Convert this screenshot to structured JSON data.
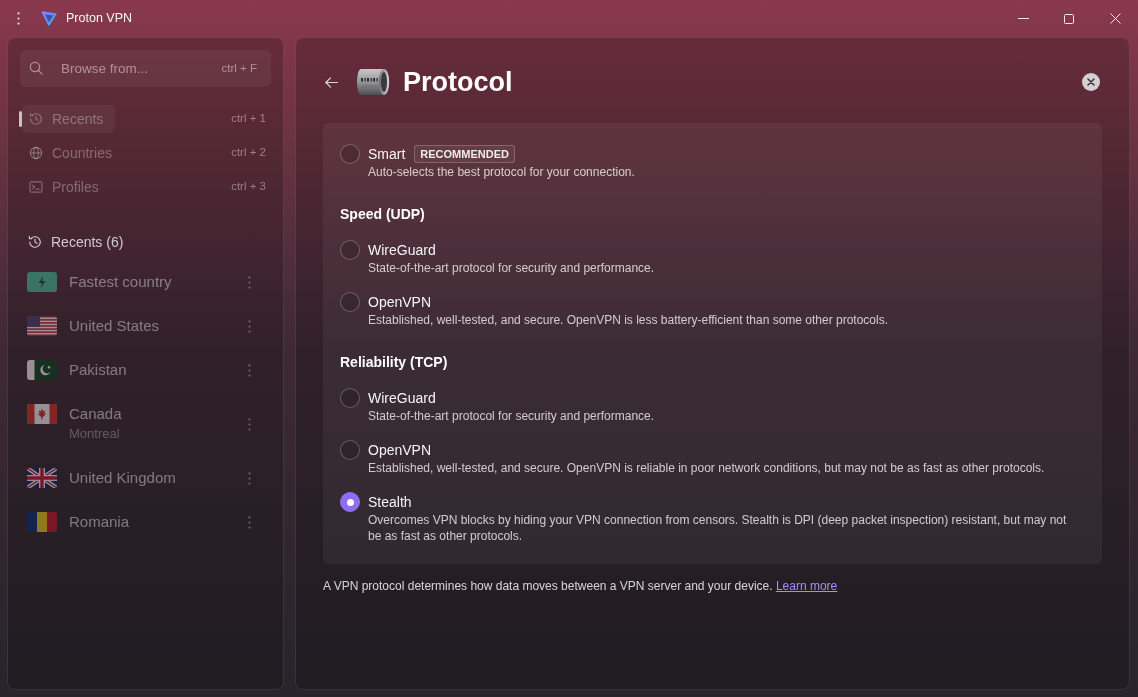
{
  "window": {
    "title": "Proton VPN"
  },
  "sidebar": {
    "search": {
      "placeholder": "Browse from...",
      "shortcut": "ctrl + F"
    },
    "nav_items": [
      {
        "kind": "recents",
        "label": "Recents",
        "shortcut": "ctrl + 1",
        "selected": true
      },
      {
        "kind": "countries",
        "label": "Countries",
        "shortcut": "ctrl + 2",
        "selected": false
      },
      {
        "kind": "profiles",
        "label": "Profiles",
        "shortcut": "ctrl + 3",
        "selected": false
      }
    ],
    "recents": {
      "title": "Recents (6)",
      "items": [
        {
          "kind": "fastest",
          "name": "Fastest country"
        },
        {
          "kind": "us",
          "name": "United States"
        },
        {
          "kind": "pk",
          "name": "Pakistan"
        },
        {
          "kind": "ca",
          "name": "Canada",
          "subtitle": "Montreal"
        },
        {
          "kind": "gb",
          "name": "United Kingdom"
        },
        {
          "kind": "ro",
          "name": "Romania"
        }
      ]
    }
  },
  "page": {
    "title": "Protocol",
    "sections": [
      {
        "options": [
          {
            "label": "Smart",
            "badge": "RECOMMENDED",
            "description": "Auto-selects the best protocol for your connection.",
            "selected": false
          }
        ]
      },
      {
        "heading": "Speed (UDP)",
        "options": [
          {
            "label": "WireGuard",
            "description": "State-of-the-art protocol for security and performance.",
            "selected": false
          },
          {
            "label": "OpenVPN",
            "description": "Established, well-tested, and secure. OpenVPN is less battery-efficient than some other protocols.",
            "selected": false
          }
        ]
      },
      {
        "heading": "Reliability (TCP)",
        "options": [
          {
            "label": "WireGuard",
            "description": "State-of-the-art protocol for security and performance.",
            "selected": false
          },
          {
            "label": "OpenVPN",
            "description": "Established, well-tested, and secure. OpenVPN is reliable in poor network conditions, but may not be as fast as other protocols.",
            "selected": false
          },
          {
            "label": "Stealth",
            "description": "Overcomes VPN blocks by hiding your VPN connection from censors. Stealth is DPI (deep packet inspection) resistant, but may not be as fast as other protocols.",
            "selected": true
          }
        ]
      }
    ],
    "note": "A VPN protocol determines how data moves between a VPN server and your device.",
    "link": "Learn more"
  }
}
